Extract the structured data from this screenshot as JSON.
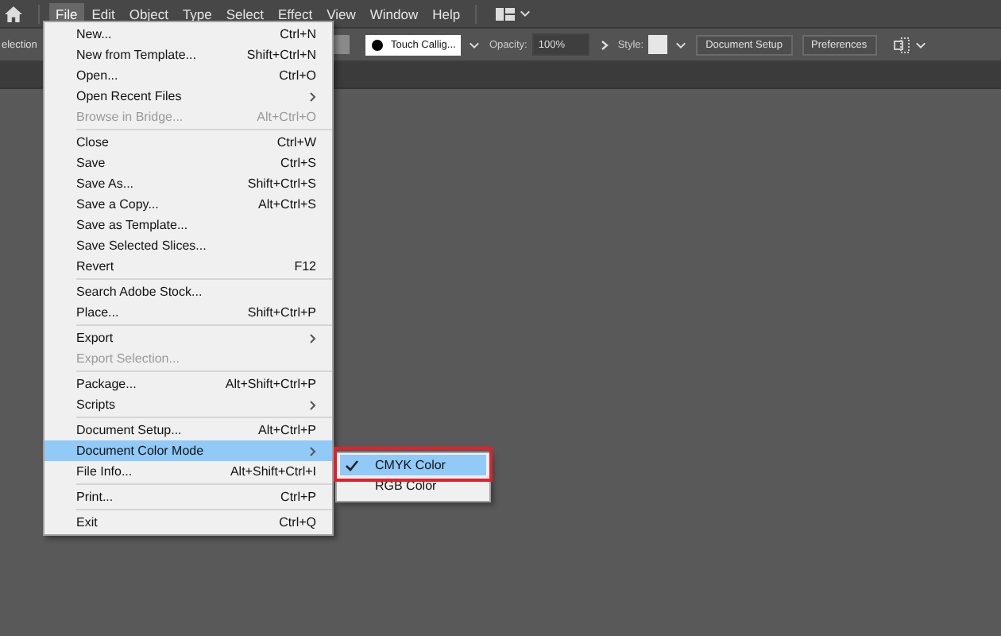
{
  "menubar": {
    "items": [
      {
        "label": "File",
        "selected": true
      },
      {
        "label": "Edit",
        "selected": false
      },
      {
        "label": "Object",
        "selected": false
      },
      {
        "label": "Type",
        "selected": false
      },
      {
        "label": "Select",
        "selected": false
      },
      {
        "label": "Effect",
        "selected": false
      },
      {
        "label": "View",
        "selected": false
      },
      {
        "label": "Window",
        "selected": false
      },
      {
        "label": "Help",
        "selected": false
      }
    ]
  },
  "control_bar": {
    "tool_label": "election",
    "brush": "Touch Callig...",
    "opacity_label": "Opacity:",
    "opacity": "100%",
    "style_label": "Style:",
    "buttons": [
      "Document Setup",
      "Preferences"
    ]
  },
  "file_menu": {
    "items": [
      {
        "kind": "item",
        "label": "New...",
        "shortcut": "Ctrl+N",
        "disabled": false,
        "selected": false
      },
      {
        "kind": "item",
        "label": "New from Template...",
        "shortcut": "Shift+Ctrl+N",
        "disabled": false,
        "selected": false
      },
      {
        "kind": "item",
        "label": "Open...",
        "shortcut": "Ctrl+O",
        "disabled": false,
        "selected": false
      },
      {
        "kind": "submenu",
        "label": "Open Recent Files",
        "disabled": false,
        "selected": false
      },
      {
        "kind": "item",
        "label": "Browse in Bridge...",
        "shortcut": "Alt+Ctrl+O",
        "disabled": true,
        "selected": false
      },
      {
        "kind": "separator"
      },
      {
        "kind": "item",
        "label": "Close",
        "shortcut": "Ctrl+W",
        "disabled": false,
        "selected": false
      },
      {
        "kind": "item",
        "label": "Save",
        "shortcut": "Ctrl+S",
        "disabled": false,
        "selected": false
      },
      {
        "kind": "item",
        "label": "Save As...",
        "shortcut": "Shift+Ctrl+S",
        "disabled": false,
        "selected": false
      },
      {
        "kind": "item",
        "label": "Save a Copy...",
        "shortcut": "Alt+Ctrl+S",
        "disabled": false,
        "selected": false
      },
      {
        "kind": "item",
        "label": "Save as Template...",
        "disabled": false,
        "selected": false
      },
      {
        "kind": "item",
        "label": "Save Selected Slices...",
        "disabled": false,
        "selected": false
      },
      {
        "kind": "item",
        "label": "Revert",
        "shortcut": "F12",
        "disabled": false,
        "selected": false
      },
      {
        "kind": "separator"
      },
      {
        "kind": "item",
        "label": "Search Adobe Stock...",
        "disabled": false,
        "selected": false
      },
      {
        "kind": "item",
        "label": "Place...",
        "shortcut": "Shift+Ctrl+P",
        "disabled": false,
        "selected": false
      },
      {
        "kind": "separator"
      },
      {
        "kind": "submenu",
        "label": "Export",
        "disabled": false,
        "selected": false
      },
      {
        "kind": "item",
        "label": "Export Selection...",
        "disabled": true,
        "selected": false
      },
      {
        "kind": "separator"
      },
      {
        "kind": "item",
        "label": "Package...",
        "shortcut": "Alt+Shift+Ctrl+P",
        "disabled": false,
        "selected": false
      },
      {
        "kind": "submenu",
        "label": "Scripts",
        "disabled": false,
        "selected": false
      },
      {
        "kind": "separator"
      },
      {
        "kind": "item",
        "label": "Document Setup...",
        "shortcut": "Alt+Ctrl+P",
        "disabled": false,
        "selected": false
      },
      {
        "kind": "submenu",
        "label": "Document Color Mode",
        "disabled": false,
        "selected": true
      },
      {
        "kind": "item",
        "label": "File Info...",
        "shortcut": "Alt+Shift+Ctrl+I",
        "disabled": false,
        "selected": false
      },
      {
        "kind": "separator"
      },
      {
        "kind": "item",
        "label": "Print...",
        "shortcut": "Ctrl+P",
        "disabled": false,
        "selected": false
      },
      {
        "kind": "separator"
      },
      {
        "kind": "item",
        "label": "Exit",
        "shortcut": "Ctrl+Q",
        "disabled": false,
        "selected": false
      }
    ]
  },
  "color_mode_submenu": {
    "items": [
      {
        "label": "CMYK Color",
        "checked": true,
        "selected": true
      },
      {
        "label": "RGB Color",
        "checked": false,
        "selected": false
      }
    ]
  }
}
